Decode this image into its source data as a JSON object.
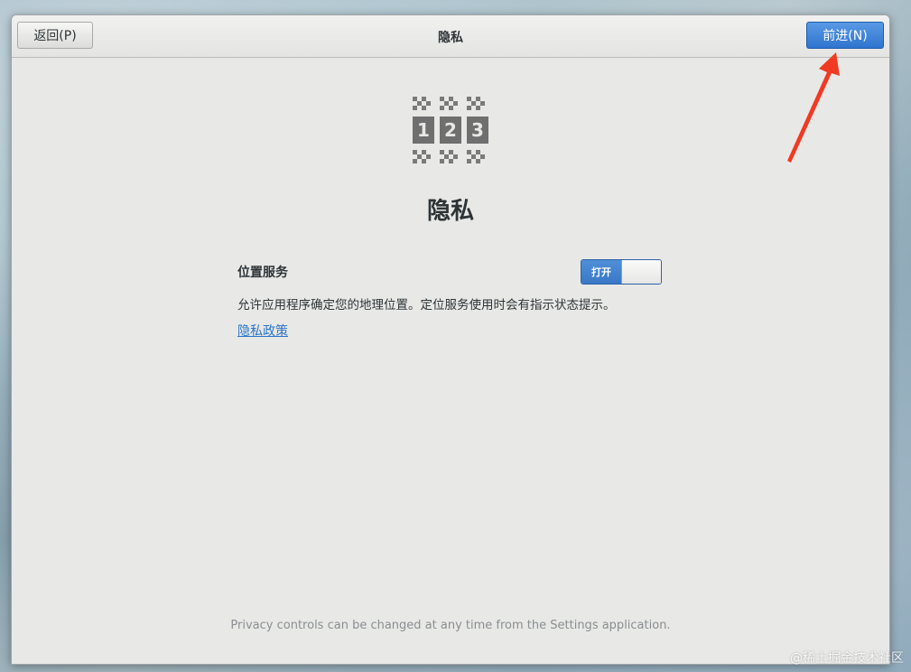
{
  "header": {
    "back_label": "返回(P)",
    "title": "隐私",
    "next_label": "前进(N)"
  },
  "main": {
    "icon": "privacy-checkered-123-icon",
    "logo_digits": [
      "1",
      "2",
      "3"
    ],
    "title": "隐私",
    "location": {
      "label": "位置服务",
      "toggle_label": "打开",
      "toggle_state": "on",
      "description": "允许应用程序确定您的地理位置。定位服务使用时会有指示状态提示。"
    },
    "policy_link": "隐私政策",
    "footer_note": "Privacy controls can be changed at any time from the Settings application."
  },
  "annotation": {
    "arrow_color": "#f03a22"
  },
  "watermark": "@稀土掘金技术社区",
  "colors": {
    "accent": "#3a78c6",
    "link": "#2a76c6"
  }
}
